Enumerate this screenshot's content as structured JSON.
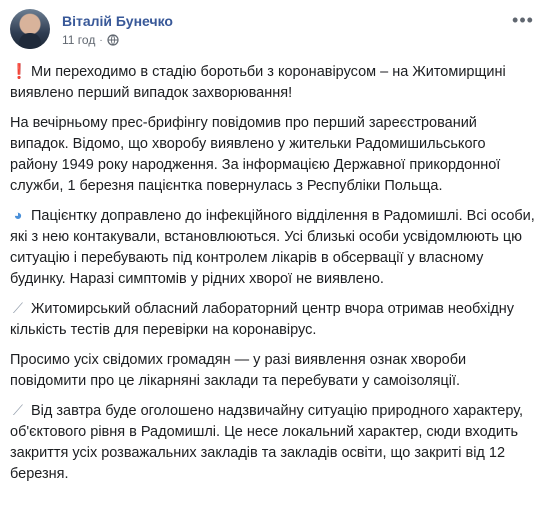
{
  "post": {
    "author": "Віталій Бунечко",
    "time": "11 год",
    "privacy_icon": "globe-icon",
    "menu_icon": "more-horizontal-icon",
    "paragraphs": [
      {
        "emoji": "❗",
        "emoji_name": "exclamation-icon",
        "text": "Ми переходимо в стадію боротьби з коронавірусом – на Житомирщині виявлено перший випадок захворювання!"
      },
      {
        "emoji": "",
        "emoji_name": "",
        "text": "На вечірньому прес-брифінгу повідомив про перший зареєстрований випадок. Відомо, що хворобу виявлено у жительки Радомишильського району 1949 року народження. За інформацією Державної прикордонної служби, 1 березня пацієнтка повернулась з Республіки Польща."
      },
      {
        "emoji": "◕",
        "emoji_name": "globe-emoji-icon",
        "text": "Пацієнтку доправлено до інфекційного відділення в Радомишлі. Всі особи, які з нею контакували, встановлюються. Усі близькі особи усвідомлюють цю ситуацію і перебувають під контролем лікарів в обсервації у власному будинку. Наразі симптомів у рідних хворої не виявлено."
      },
      {
        "emoji": "⟋",
        "emoji_name": "syringe-icon",
        "text": "Житомирський обласний лабораторний центр вчора отримав необхідну кількість тестів для перевірки на коронавірус."
      },
      {
        "emoji": "",
        "emoji_name": "",
        "text": "Просимо усіх свідомих громадян — у разі виявлення ознак хвороби повідомити про це лікарняні заклади та перебувати у самоізоляції."
      },
      {
        "emoji": "⟋",
        "emoji_name": "syringe-icon",
        "text": "Від завтра буде оголошено надзвичайну ситуацію природного характеру, об'єктового рівня в Радомишлі. Це несе локальний характер, сюди входить закриття усіх розважальних закладів та закладів освіти, що закриті від 12 березня."
      }
    ]
  },
  "colors": {
    "author": "#385898",
    "meta": "#606770",
    "text": "#1c1e21"
  }
}
